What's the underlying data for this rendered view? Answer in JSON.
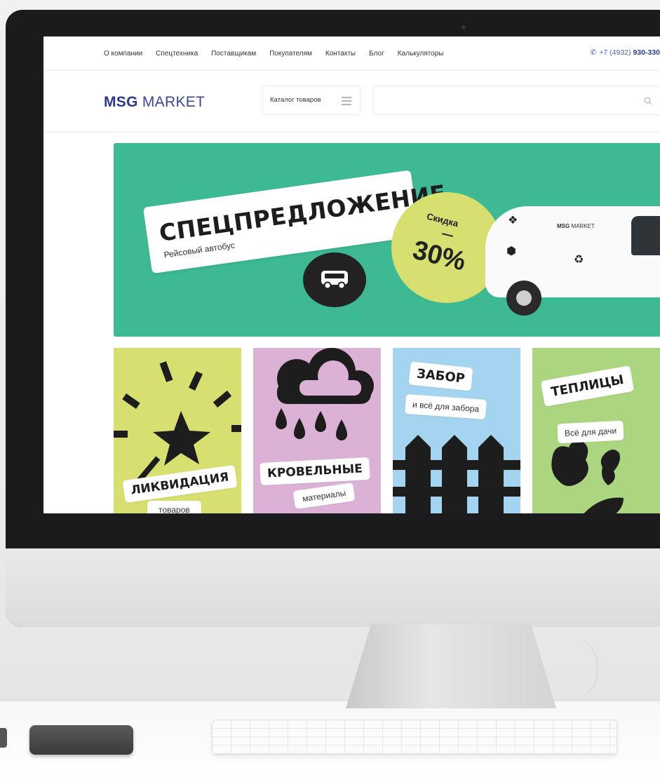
{
  "nav": {
    "links": [
      "О компании",
      "Спецтехника",
      "Поставщикам",
      "Покупателям",
      "Контакты",
      "Блог",
      "Калькуляторы"
    ],
    "phone_prefix": "+7 (4932)",
    "phone_main": "930-330"
  },
  "header": {
    "logo_bold": "MSG",
    "logo_light": "MARKET",
    "catalog_label": "Каталог товаров",
    "search_placeholder": ""
  },
  "hero": {
    "title": "СПЕЦПРЕДЛОЖЕНИЕ",
    "subtitle": "Рейсовый автобус",
    "discount_label": "Скидка",
    "discount_value": "30%",
    "van_logo_bold": "MSG",
    "van_logo_light": "MARKET"
  },
  "tiles": [
    {
      "title": "ЛИКВИДАЦИЯ",
      "subtitle": "товаров",
      "color": "#d6df6f"
    },
    {
      "title": "КРОВЕЛЬНЫЕ",
      "subtitle": "материалы",
      "color": "#dbb2d6"
    },
    {
      "title": "ЗАБОР",
      "subtitle": "и всё для забора",
      "color": "#a4d4f0"
    },
    {
      "title": "ТЕПЛИЦЫ",
      "subtitle": "Всё для дачи",
      "color": "#acd57f"
    }
  ],
  "colors": {
    "brand": "#2b3a86",
    "hero_bg": "#3dba93",
    "discount_bg": "#d6df6f"
  }
}
